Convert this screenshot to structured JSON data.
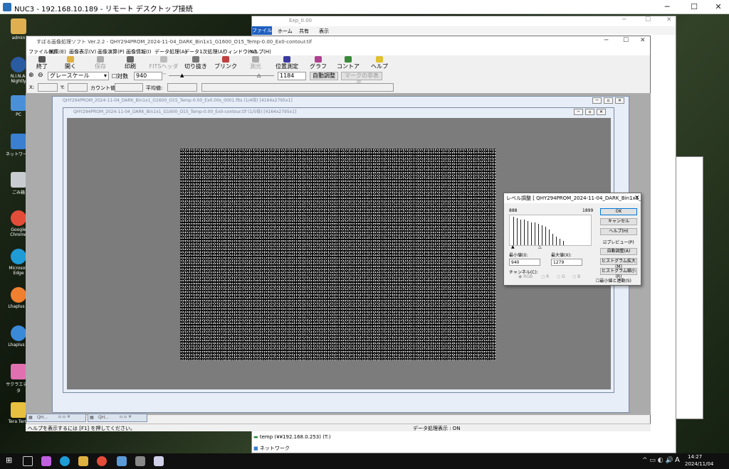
{
  "remote": {
    "title": "NUC3 - 192.168.10.189 - リモート デスクトップ接続"
  },
  "desktop_icons": [
    "admin",
    "N.I.N.A. Nightly",
    "PC",
    "ネットワーク",
    "ごみ箱",
    "Google Chrome",
    "Microsoft Edge",
    "Lhaplus B",
    "Lhaplus R",
    "サクラエディタ",
    "Tera Term"
  ],
  "explorer": {
    "path": "Exp_0.00",
    "file_tab": "ファイル",
    "tabs": [
      "ホーム",
      "共有",
      "表示"
    ],
    "nav_items": [
      "temp (¥¥192.168.0.253) (T:)",
      "ネットワーク"
    ]
  },
  "app": {
    "title": "すばる画像処理ソフト Ver.2.2 - QHY294PROM_2024-11-04_DARK_Bin1x1_G1600_O15_Temp-0.00_Ex0-contour.tif",
    "menu": [
      "ファイル(F)",
      "編集(E)",
      "画像表示(V)",
      "画像演算(P)",
      "画像情報(I)",
      "データ処理(A)",
      "データ1次処理(A)",
      "ウィンドウ(W)",
      "ヘルプ(H)"
    ],
    "toolbar": [
      "終了",
      "開く",
      "保存",
      "印刷",
      "FITSヘッダー",
      "切り抜き",
      "ブリンク",
      "測光",
      "位置測定",
      "グラフ",
      "コントア",
      "ヘルプ"
    ],
    "colormap": "グレースケール",
    "log_label": "対数",
    "min_value": "940",
    "max_value": "1184",
    "auto_adjust": "自動調整",
    "hide_marks": "マークの非表示...",
    "x_label": "X:",
    "y_label": "Y:",
    "count_label": "カウント値:",
    "avg_label": "平均値:",
    "status_help": "ヘルプを表示するには [F1] を押してください。",
    "status_data": "データ処理表示 : ON"
  },
  "child1": {
    "title": "QHY294PROM_2024-11-04_DARK_Bin1x1_G1600_O15_Temp-0.00_Ex0.00s_0001.fits (1/4倍) [4164x2795x1]"
  },
  "child2": {
    "title": "QHY294PROM_2024-11-04_DARK_Bin1x1_G1600_O15_Temp-0.00_Ex0-contour.tif (1/5倍) [4164x2795x1]"
  },
  "minimized": [
    "QH...",
    "QH..."
  ],
  "dialog": {
    "title": "レベル調整 [ QHY294PROM_2024-11-04_DARK_Bin1x1_G1600_O15_Temp-0.00_Ex0-contour.tif ]",
    "hist_min": "888",
    "hist_max": "1899",
    "min_label": "最小値(I):",
    "max_label": "最大値(X):",
    "min_value": "940",
    "max_value": "1279",
    "channel_label": "チャンネル(C):",
    "channels": [
      "RGB",
      "R",
      "G",
      "B"
    ],
    "ok": "OK",
    "cancel": "キャンセル",
    "help": "ヘルプ(H)",
    "preview": "プレビュー(P)",
    "auto": "自動調整(A)",
    "hist_expand": "ヒストグラム拡大(M)",
    "hist_shrink": "ヒストグラム縮小(R)",
    "link": "最小値と連動(S)",
    "histogram_levels": [
      1.0,
      0.95,
      0.9,
      0.9,
      0.85,
      0.8,
      0.8,
      0.75,
      0.7,
      0.65,
      0.55,
      0.4,
      0.3,
      0.22,
      0.15
    ]
  },
  "clock": {
    "time": "14:27",
    "date": "2024/11/04",
    "ime": "A"
  }
}
